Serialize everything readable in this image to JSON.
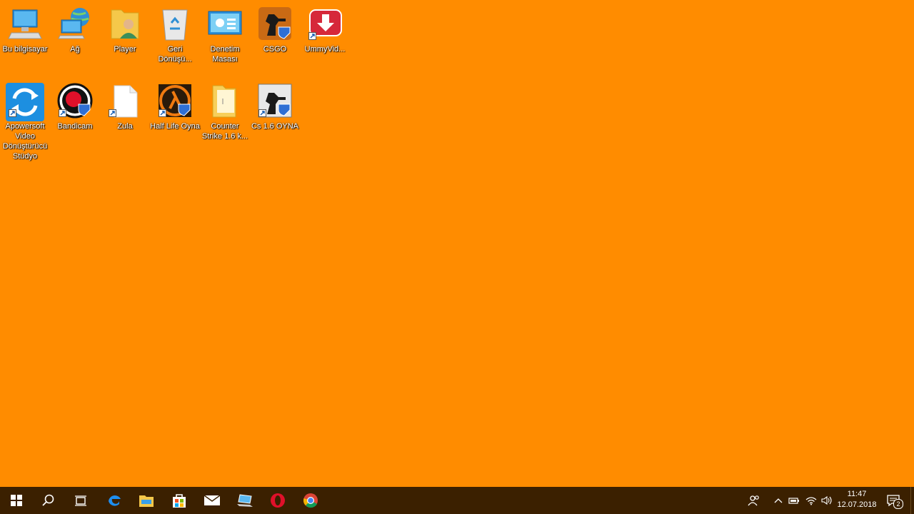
{
  "desktop": {
    "icons": [
      {
        "label": "Bu bilgisayar",
        "icon": "computer-icon"
      },
      {
        "label": "Ağ",
        "icon": "network-icon"
      },
      {
        "label": "Player",
        "icon": "user-folder-icon"
      },
      {
        "label": "Geri Dönüşü...",
        "icon": "recycle-bin-icon"
      },
      {
        "label": "Denetim Masası",
        "icon": "control-panel-icon"
      },
      {
        "label": "CSGO",
        "icon": "csgo-icon"
      },
      {
        "label": "UmmyVid...",
        "icon": "ummy-video-icon"
      },
      {
        "label": "Apowersoft Video Dönüştürücü Stüdyo",
        "icon": "apowersoft-icon"
      },
      {
        "label": "Bandicam",
        "icon": "bandicam-icon"
      },
      {
        "label": "Zula",
        "icon": "blank-file-icon"
      },
      {
        "label": "Half Life Oyna",
        "icon": "half-life-icon"
      },
      {
        "label": "Counter Strike 1.6 k...",
        "icon": "folder-icon"
      },
      {
        "label": "Cs 1.6 OYNA",
        "icon": "cs16-icon"
      }
    ]
  },
  "taskbar": {
    "pinned": [
      "start-icon",
      "search-icon",
      "task-view-icon",
      "edge-icon",
      "file-explorer-icon",
      "store-icon",
      "mail-icon",
      "laptop-app-icon",
      "opera-icon",
      "chrome-icon"
    ],
    "tray_icons": [
      "people-icon",
      "chevron-up-icon",
      "battery-icon",
      "wifi-icon",
      "volume-icon"
    ],
    "clock": {
      "time": "11:47",
      "date": "12.07.2018"
    },
    "notifications": {
      "count": "2"
    }
  },
  "colors": {
    "desktop_background": "#FF8C00",
    "taskbar": "#3B2000"
  }
}
